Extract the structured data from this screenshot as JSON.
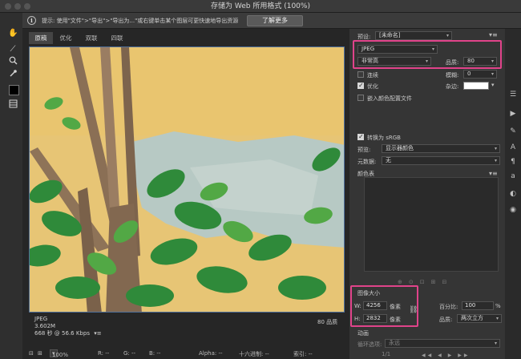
{
  "window": {
    "title": "存储为 Web 所用格式 (100%)"
  },
  "infobar": {
    "tip": "提示: 使用\"文件\">\"导出\">\"导出为...\"或右键单击某个图层可更快速地导出资源",
    "learn_more": "了解更多"
  },
  "tabs": [
    {
      "label": "原稿"
    },
    {
      "label": "优化"
    },
    {
      "label": "双联"
    },
    {
      "label": "四联"
    }
  ],
  "image_info": {
    "format": "JPEG",
    "size": "3.602M",
    "time": "668 秒 @ 56.6 Kbps",
    "menu": "▾≡",
    "quality": "80 品质"
  },
  "statusbar": {
    "zoom": "100%",
    "r": "R: --",
    "g": "G: --",
    "b": "B: --",
    "alpha": "Alpha: --",
    "hex": "十六进制: --",
    "index": "索引: --"
  },
  "panel": {
    "preset_label": "预设:",
    "preset_value": "[未命名]",
    "format": "JPEG",
    "quality_preset": "非常高",
    "quality_label": "品质:",
    "quality_value": "80",
    "progressive_label": "连续",
    "blur_label": "模糊:",
    "blur_value": "0",
    "optimized_label": "优化",
    "matte_label": "杂边:",
    "embed_profile_label": "嵌入颜色配置文件",
    "convert_srgb_label": "转换为 sRGB",
    "preview_label": "预览:",
    "preview_value": "显示器颜色",
    "metadata_label": "元数据:",
    "metadata_value": "无",
    "color_table_label": "颜色表",
    "image_size_label": "图像大小",
    "width_label": "W:",
    "width_value": "4256",
    "height_label": "H:",
    "height_value": "2832",
    "unit_px": "像素",
    "percent_label": "百分比:",
    "percent_value": "100",
    "percent_unit": "%",
    "resample_label": "品质:",
    "resample_value": "两次立方",
    "animation_label": "动画",
    "loop_label": "循环选项:",
    "loop_value": "永远",
    "frame_counter": "1/1"
  },
  "colors": {
    "highlight": "#e0438a",
    "viewport_border": "#4f6f9a",
    "panel_bg": "#353535"
  }
}
